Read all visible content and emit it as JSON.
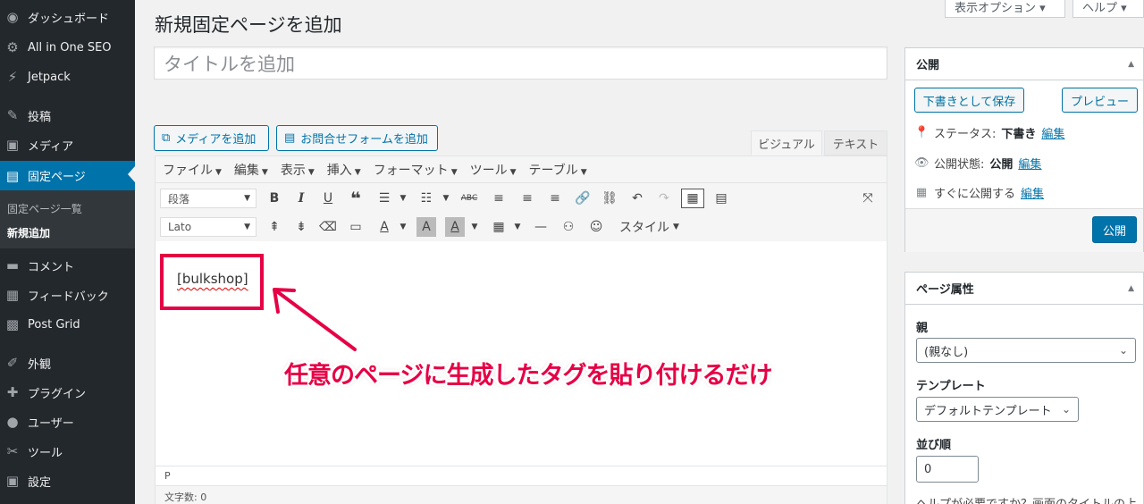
{
  "sidebar": {
    "items": [
      {
        "icon": "dashboard-icon",
        "glyph": "◉",
        "label": "ダッシュボード"
      },
      {
        "icon": "gear-icon",
        "glyph": "⚙",
        "label": "All in One SEO"
      },
      {
        "icon": "jetpack-icon",
        "glyph": "⚡",
        "label": "Jetpack"
      },
      {
        "icon": "pin-icon",
        "glyph": "✎",
        "label": "投稿"
      },
      {
        "icon": "media-icon",
        "glyph": "▣",
        "label": "メディア"
      },
      {
        "icon": "page-icon",
        "glyph": "▤",
        "label": "固定ページ"
      },
      {
        "icon": "comment-icon",
        "glyph": "▬",
        "label": "コメント"
      },
      {
        "icon": "feedback-icon",
        "glyph": "▦",
        "label": "フィードバック"
      },
      {
        "icon": "grid-icon",
        "glyph": "▩",
        "label": "Post Grid"
      },
      {
        "icon": "appearance-icon",
        "glyph": "✐",
        "label": "外観"
      },
      {
        "icon": "plugin-icon",
        "glyph": "✚",
        "label": "プラグイン"
      },
      {
        "icon": "user-icon",
        "glyph": "●",
        "label": "ユーザー"
      },
      {
        "icon": "tool-icon",
        "glyph": "✂",
        "label": "ツール"
      },
      {
        "icon": "settings-icon",
        "glyph": "▣",
        "label": "設定"
      }
    ],
    "submenu": {
      "all_pages": "固定ページ一覧",
      "add_new": "新規追加"
    }
  },
  "screen_options": {
    "options_label": "表示オプション ▾",
    "help_label": "ヘルプ ▾"
  },
  "page_title": "新規固定ページを追加",
  "title_placeholder": "タイトルを追加",
  "media_buttons": {
    "add_media": "メディアを追加",
    "add_form": "お問合せフォームを追加"
  },
  "editor_tabs": {
    "visual": "ビジュアル",
    "text": "テキスト"
  },
  "menubar": [
    "ファイル",
    "編集",
    "表示",
    "挿入",
    "フォーマット",
    "ツール",
    "テーブル"
  ],
  "toolbar": {
    "format_select": "段落",
    "font_select": "Lato",
    "style_label": "スタイル"
  },
  "content": {
    "shortcode": "[bulkshop]",
    "annotation": "任意のページに生成したタグを貼り付けるだけ"
  },
  "status": {
    "path": "P",
    "word_count": "文字数: 0"
  },
  "publish_box": {
    "title": "公開",
    "save_draft": "下書きとして保存",
    "preview": "プレビュー",
    "status_label": "ステータス:",
    "status_value": "下書き",
    "visibility_label": "公開状態:",
    "visibility_value": "公開",
    "schedule_label": "すぐに公開する",
    "edit_link": "編集",
    "publish_button": "公開"
  },
  "attributes_box": {
    "title": "ページ属性",
    "parent_label": "親",
    "parent_value": "(親なし)",
    "template_label": "テンプレート",
    "template_value": "デフォルトテンプレート",
    "order_label": "並び順",
    "order_value": "0",
    "help_text": "ヘルプが必要ですか？画面のタイトルの上"
  },
  "colors": {
    "accent": "#0073aa",
    "annotation": "#e60045",
    "sidebar": "#23282d"
  }
}
